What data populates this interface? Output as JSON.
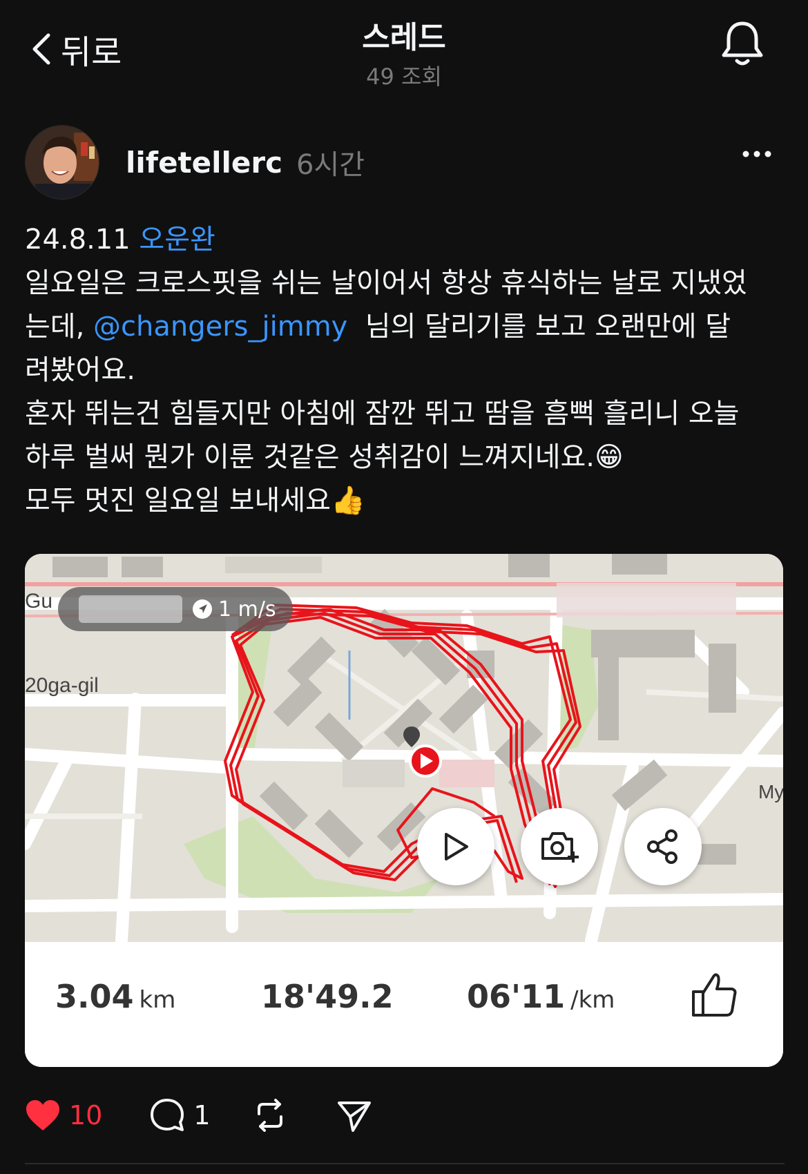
{
  "header": {
    "back_label": "뒤로",
    "title": "스레드",
    "views": "49 조회"
  },
  "post": {
    "username": "lifetellerc",
    "time": "6시간",
    "date": "24.8.11",
    "hashtag": "오운완",
    "line1a": "일요일은 크로스핏을 쉬는 날이어서 항상 휴식하는 날로 지냈었",
    "line1b": "는데, ",
    "mention": "@changers_jimmy",
    "line1c": "  님의 달리기를 보고 오랜만에 달",
    "line1d": "려봤어요.",
    "line2a": "혼자 뛰는건 힘들지만 아침에 잠깐 뛰고 땀을 흠뻑 흘리니 오늘",
    "line2b": "하루 벌써 뭔가 이룬 것같은 성취감이 느껴지네요.",
    "emoji1": "😁",
    "line3": "모두 멋진 일요일 보내세요",
    "emoji2": "👍"
  },
  "map": {
    "speed": "1 m/s",
    "street1": "Gu",
    "street2": "20ga-gil",
    "street3": "My",
    "route_color": "#e8141b"
  },
  "stats": {
    "distance": "3.04",
    "distance_unit": "km",
    "duration": "18'49.2",
    "pace": "06'11",
    "pace_unit": "/km"
  },
  "actions": {
    "likes": "10",
    "comments": "1"
  },
  "colors": {
    "accent": "#3a96ff",
    "like": "#ff3040",
    "background": "#101010"
  }
}
